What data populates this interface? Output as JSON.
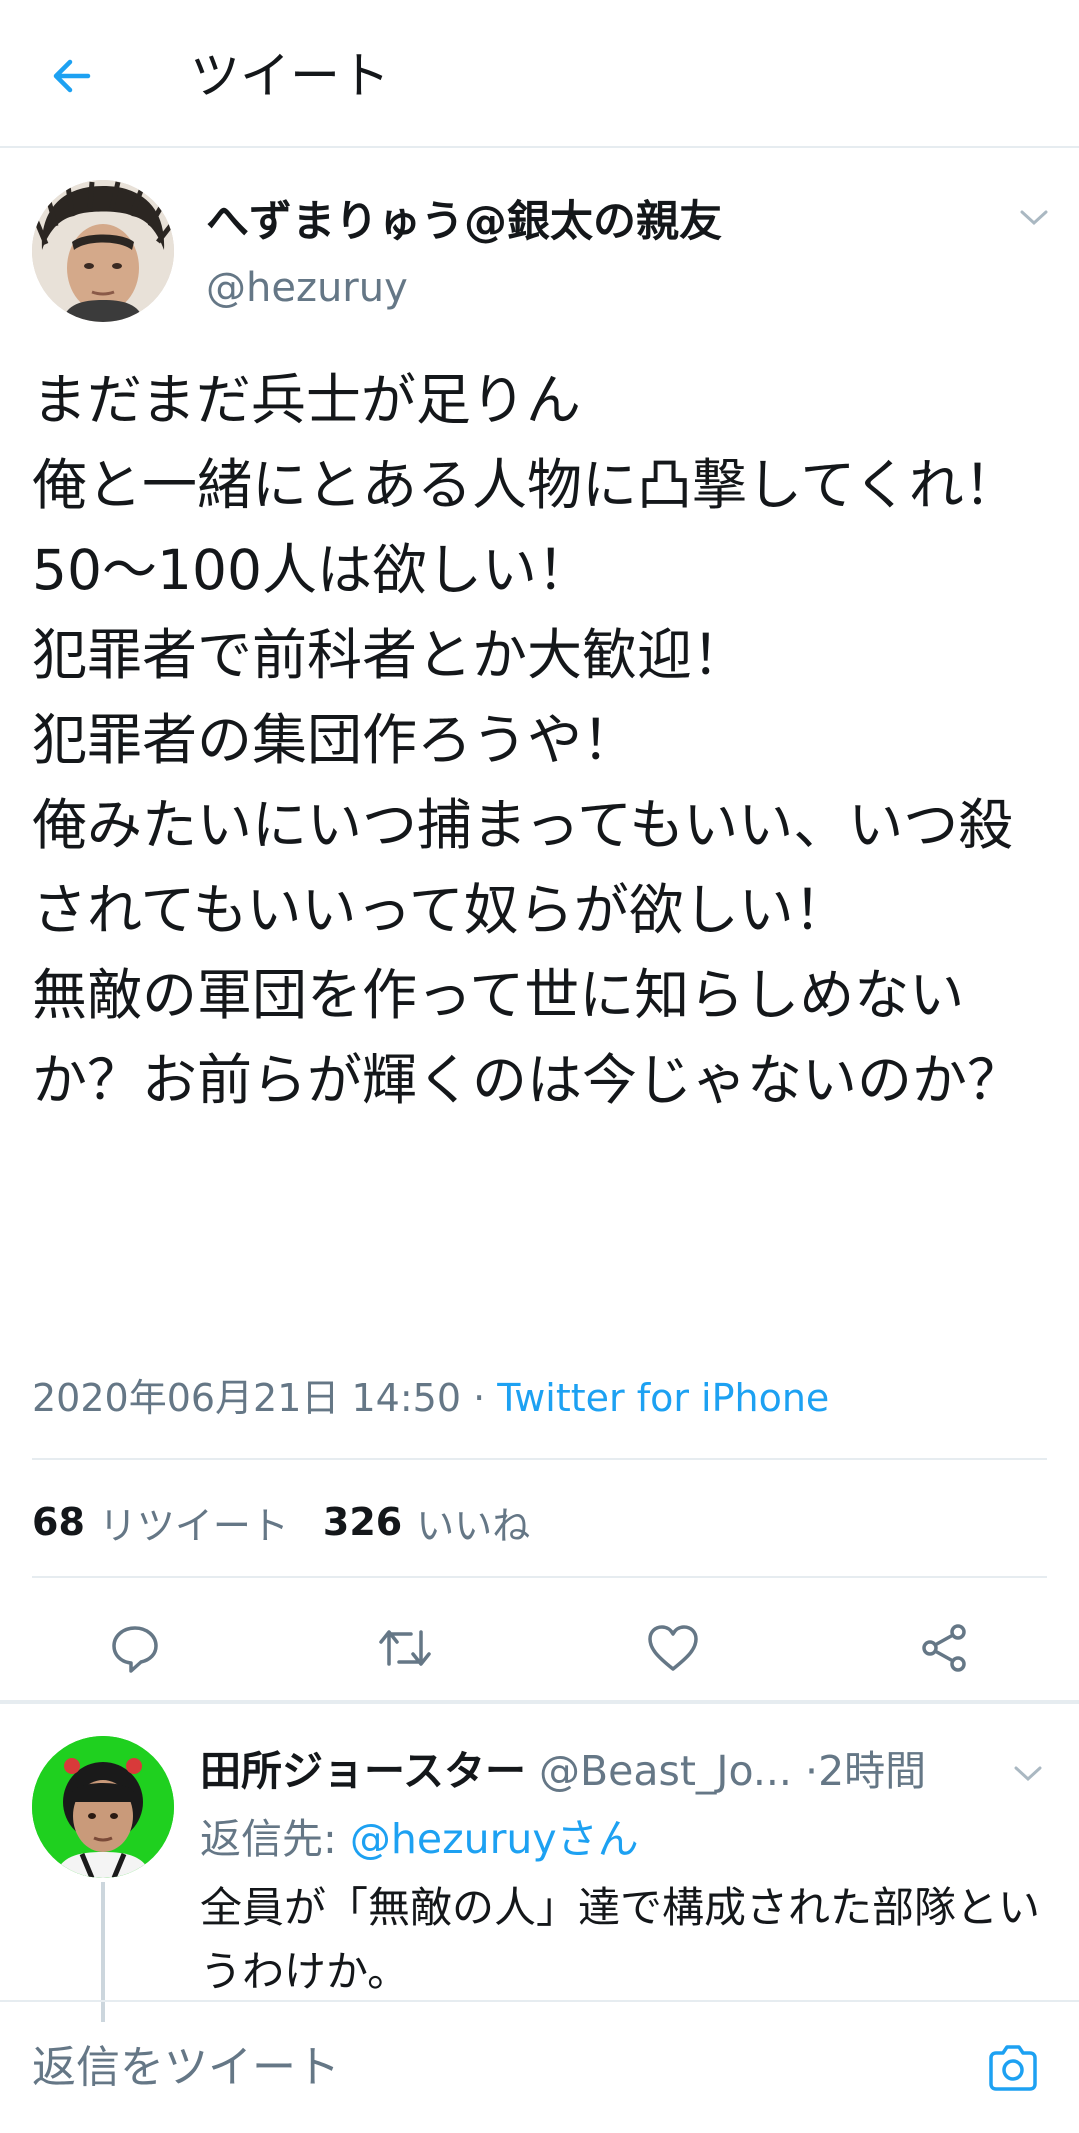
{
  "header": {
    "title": "ツイート"
  },
  "tweet": {
    "author_name": "へずまりゅう@銀太の親友",
    "author_handle": "@hezuruy",
    "text": "まだまだ兵士が足りん\n俺と一緒にとある人物に凸撃してくれ！\n50〜100人は欲しい！\n犯罪者で前科者とか大歓迎！\n犯罪者の集団作ろうや！\n俺みたいにいつ捕まってもいい、いつ殺されてもいいって奴らが欲しい！\n無敵の軍団を作って世に知らしめないか？お前らが輝くのは今じゃないのか？",
    "timestamp": "2020年06月21日 14:50",
    "separator": " · ",
    "source": "Twitter for iPhone",
    "retweet_count": "68",
    "retweet_label": "リツイート",
    "like_count": "326",
    "like_label": "いいね"
  },
  "reply": {
    "author_name": "田所ジョースター",
    "author_handle": "@Beast_Jo...",
    "dot": "·",
    "time": "2時間",
    "replying_prefix": "返信先: ",
    "replying_mention": "@hezuruyさん",
    "text": "全員が「無敵の人」達で構成された部隊というわけか。"
  },
  "compose": {
    "placeholder": "返信をツイート"
  },
  "colors": {
    "accent": "#1da1f2",
    "secondary_text": "#657786",
    "divider": "#e6ecf0"
  },
  "icons": {
    "back": "arrow-left-icon",
    "menu": "chevron-down-icon",
    "reply": "comment-icon",
    "retweet": "retweet-icon",
    "like": "heart-icon",
    "share": "share-icon",
    "camera": "camera-icon"
  }
}
